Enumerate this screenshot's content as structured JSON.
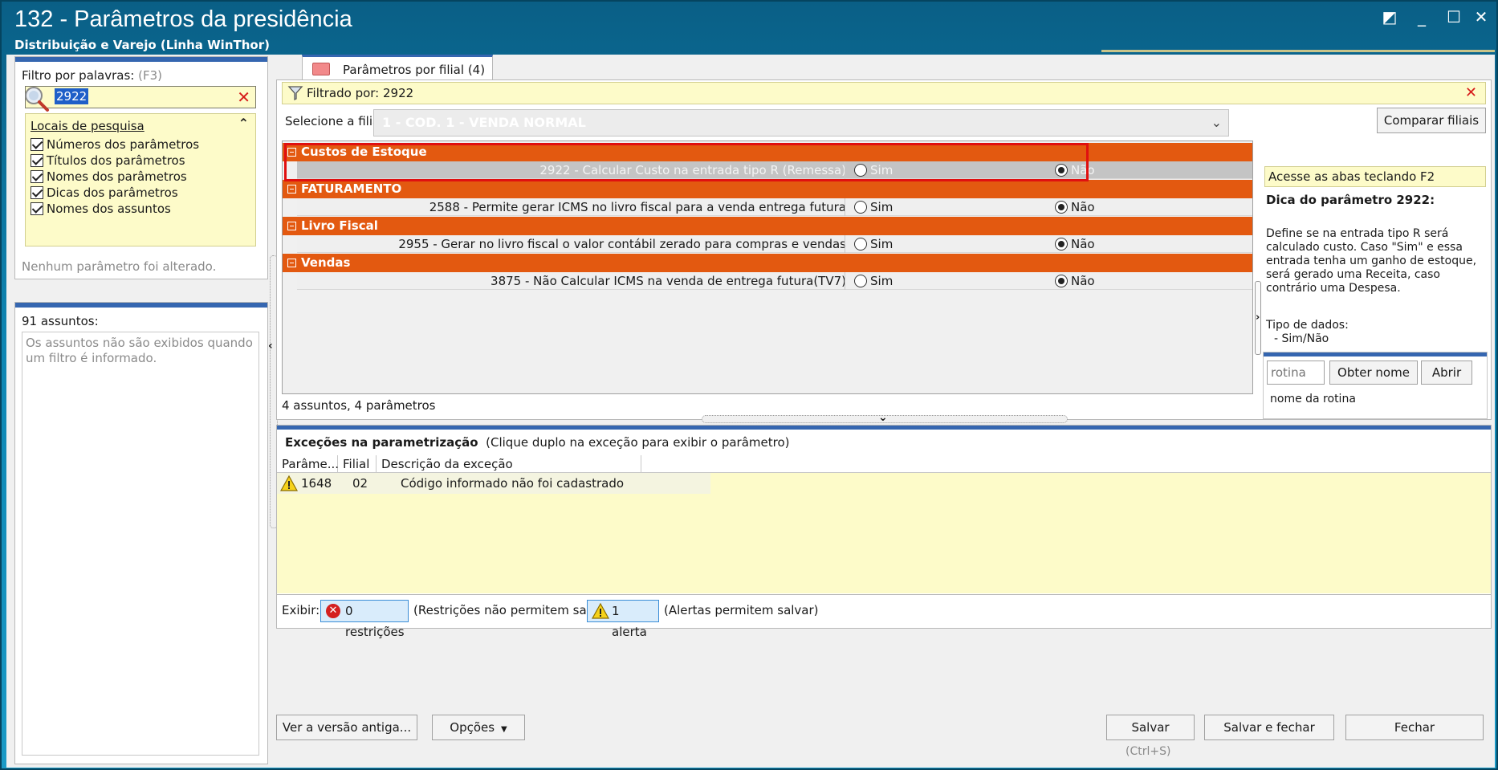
{
  "window": {
    "title": "132 - Parâmetros da presidência",
    "subtitle": "Distribuição e Varejo (Linha WinThor)",
    "controls": {
      "restore": "◩",
      "minimize": "_",
      "maximize": "☐",
      "close": "✕"
    }
  },
  "left": {
    "filter_label": "Filtro por palavras:",
    "filter_hint": "(F3)",
    "search_value": "2922",
    "locais_title": "Locais de pesquisa",
    "locais": [
      "Números dos parâmetros",
      "Títulos dos parâmetros",
      "Nomes dos parâmetros",
      "Dicas dos parâmetros",
      "Nomes dos assuntos"
    ],
    "nenhum_alterado": "Nenhum parâmetro foi alterado.",
    "assuntos_count": "91 assuntos:",
    "assuntos_msg": "Os assuntos não são exibidos quando um filtro é informado."
  },
  "tab": {
    "label": "Parâmetros por filial",
    "count": "(4)"
  },
  "filter_bar": {
    "text": "Filtrado por: 2922"
  },
  "filial": {
    "label": "Selecione a filial:",
    "value": "1 - COD. 1 - VENDA NORMAL",
    "compare_button": "Comparar filiais"
  },
  "groups": [
    {
      "name": "Custos de Estoque",
      "params": [
        {
          "desc": "2922 - Calcular Custo na entrada tipo R (Remessa)",
          "value": "Não",
          "selected": true
        }
      ]
    },
    {
      "name": "FATURAMENTO",
      "params": [
        {
          "desc": "2588 - Permite gerar ICMS no livro fiscal para a venda entrega futura",
          "value": "Não",
          "selected": false
        }
      ]
    },
    {
      "name": "Livro Fiscal",
      "params": [
        {
          "desc": "2955 - Gerar no livro fiscal o valor contábil zerado para compras e vendas",
          "value": "Não",
          "selected": false
        }
      ]
    },
    {
      "name": "Vendas",
      "params": [
        {
          "desc": "3875 - Não Calcular ICMS na venda de entrega futura(TV7)",
          "value": "Não",
          "selected": false
        }
      ]
    }
  ],
  "radio_labels": {
    "sim": "Sim",
    "nao": "Não"
  },
  "count_text": "4 assuntos, 4 parâmetros",
  "tip": {
    "hint": "Acesse as abas teclando F2",
    "title": "Dica do parâmetro 2922:",
    "body": "Define se na entrada tipo R será calculado custo. Caso \"Sim\" e essa entrada tenha um ganho de estoque, será gerado uma Receita, caso contrário uma Despesa.",
    "type_label": "Tipo de dados:",
    "type_value": "- Sim/Não"
  },
  "rotina": {
    "placeholder": "rotina",
    "obter_button": "Obter nome",
    "abrir_button": "Abrir",
    "nome": "nome da rotina"
  },
  "exceptions": {
    "title": "Exceções na parametrização",
    "subtitle": "(Clique duplo na exceção para exibir o parâmetro)",
    "columns": [
      "Parâme...",
      "Filial",
      "Descrição da exceção"
    ],
    "rows": [
      {
        "param": "1648",
        "filial": "02",
        "desc": "Código informado não foi cadastrado"
      }
    ]
  },
  "exibir": {
    "label": "Exibir:",
    "restricoes_button": "0 restrições",
    "restricoes_note": "(Restrições não permitem salvar)",
    "alerta_button": "1 alerta",
    "alerta_note": "(Alertas permitem salvar)"
  },
  "buttons": {
    "ver_versao": "Ver a versão antiga...",
    "opcoes": "Opções",
    "salvar": "Salvar",
    "salvar_shortcut": "(Ctrl+S)",
    "salvar_fechar": "Salvar e fechar",
    "fechar": "Fechar"
  },
  "colors": {
    "group_orange": "#e35910",
    "accent_blue": "#3566b0",
    "highlight_red": "#e01010",
    "tip_yellow": "#fdfbc9"
  }
}
